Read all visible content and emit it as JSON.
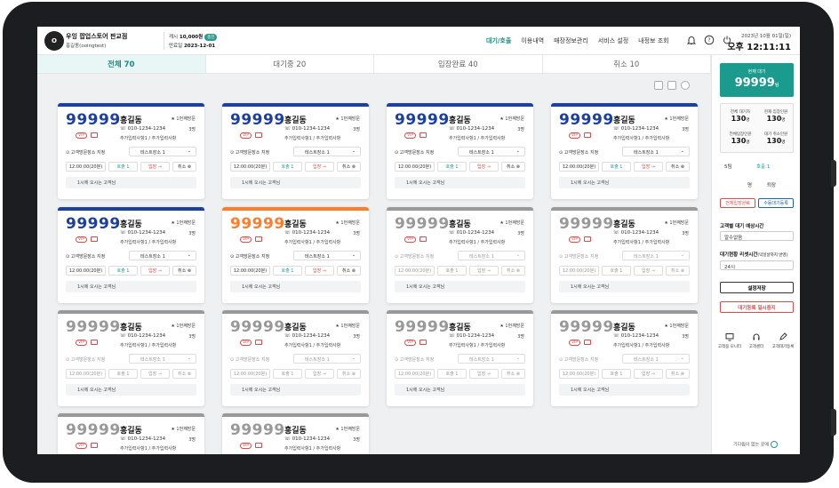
{
  "store": {
    "logo": "O",
    "name": "우잉 팝업스토어 판교점",
    "id": "홍길동(ooingtest)"
  },
  "plan": {
    "label1": "캐시",
    "value1": "10,000원",
    "badge": "충전",
    "label2": "만료일",
    "value2": "2023-12-01"
  },
  "nav": [
    "대기/호출",
    "이용내역",
    "매장정보관리",
    "서비스 설정",
    "내정보 조회"
  ],
  "datetime": {
    "date": "2023년 10월 01일(일)",
    "time": "오후 12:11:11"
  },
  "tabs": [
    {
      "label": "전체 70"
    },
    {
      "label": "대기중 20"
    },
    {
      "label": "입장완료 40"
    },
    {
      "label": "취소 10"
    }
  ],
  "card_template": {
    "number": "99999",
    "vip": "VIP",
    "name": "홍길동",
    "visit": "1번째방문",
    "phone": "010-1234-1234",
    "people": "3명",
    "extra": "추가입력사항1 / 추가입력사항",
    "location": "고객방문장소 지정",
    "location_select": "테스트장소 1",
    "time": "12:00:00(20분)",
    "call": "호출",
    "call_count": "1",
    "enter": "입장",
    "cancel": "취소",
    "memo": "1시에 오시는 고객님"
  },
  "cards": [
    {
      "state": "active",
      "color": "#1d3f9e"
    },
    {
      "state": "active",
      "color": "#1d3f9e"
    },
    {
      "state": "active",
      "color": "#1d3f9e"
    },
    {
      "state": "active",
      "color": "#1d3f9e"
    },
    {
      "state": "active",
      "color": "#1d3f9e"
    },
    {
      "state": "called",
      "color": "#ff7d2a"
    },
    {
      "state": "done",
      "color": "#999"
    },
    {
      "state": "done",
      "color": "#999"
    },
    {
      "state": "done",
      "color": "#999"
    },
    {
      "state": "done",
      "color": "#999"
    },
    {
      "state": "done",
      "color": "#999"
    },
    {
      "state": "done",
      "color": "#999"
    },
    {
      "state": "done",
      "color": "#999"
    },
    {
      "state": "done",
      "color": "#999"
    }
  ],
  "sidebar": {
    "waiting_label": "현재 대기",
    "waiting_value": "99999",
    "waiting_unit": "팀",
    "stats": [
      {
        "label": "전체 대기자",
        "value": "130",
        "unit": "명"
      },
      {
        "label": "현재 입장인원",
        "value": "130",
        "unit": "명"
      },
      {
        "label": "전체입장인원",
        "value": "130",
        "unit": "명"
      },
      {
        "label": "대기 취소인원",
        "value": "130",
        "unit": "명"
      }
    ],
    "count_select": "5팀",
    "call_btn": "호출",
    "call_count": "1",
    "enter_small": "명",
    "enter_label": "퇴장",
    "btn_all_enter": "전체입장완료",
    "btn_manual": "수동대기등록",
    "est_label": "고객별 대기 예상시간",
    "est_value": "알수없음",
    "reset_label": "대기현황 리셋시간",
    "reset_sub": "(익일날까지 반영)",
    "reset_value": "24시",
    "save_btn": "설정저장",
    "pause_btn": "대기등록 일시중지",
    "footer": [
      {
        "label": "고객용 모니터"
      },
      {
        "label": "고객센터"
      },
      {
        "label": "고객대기등록"
      }
    ],
    "powered": "기다림이 없는 곳에"
  }
}
